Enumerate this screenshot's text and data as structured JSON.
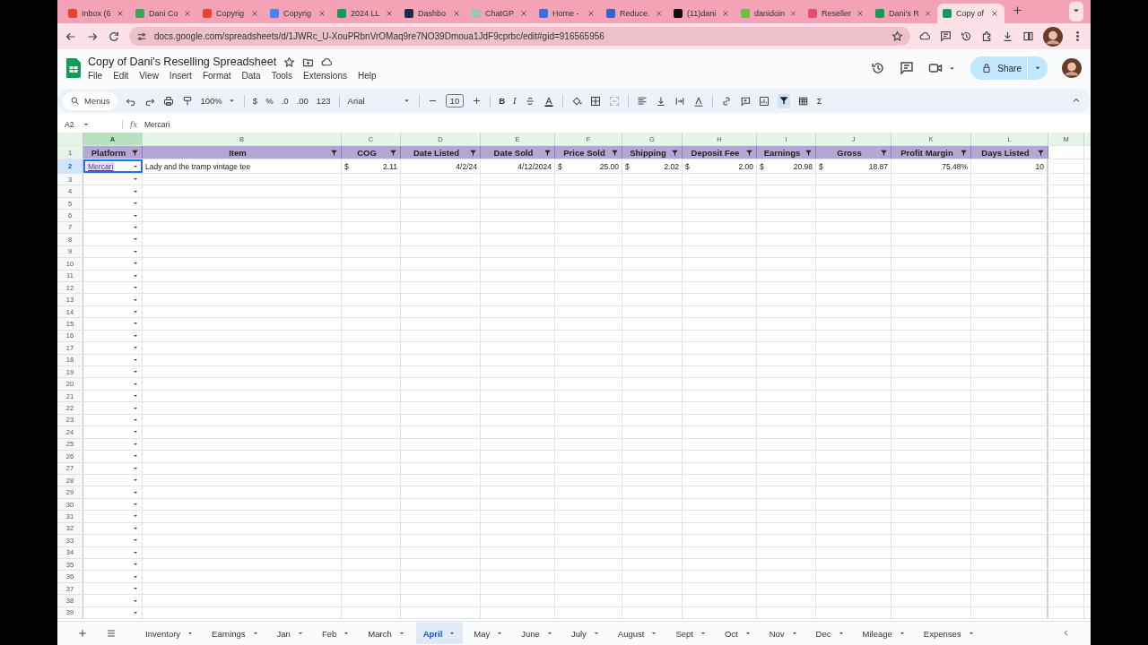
{
  "browser": {
    "tabs": [
      {
        "label": "Inbox (6",
        "color": "#ea4335",
        "selected": false
      },
      {
        "label": "Dani Co",
        "color": "#34a853",
        "selected": false
      },
      {
        "label": "Copyrig",
        "color": "#ea4335",
        "selected": false
      },
      {
        "label": "Copyrig",
        "color": "#4285f4",
        "selected": false
      },
      {
        "label": "2024 LL",
        "color": "#0f9d58",
        "selected": false
      },
      {
        "label": "Dashbo",
        "color": "#1a2a4a",
        "selected": false
      },
      {
        "label": "ChatGP",
        "color": "#9fc3b4",
        "selected": false
      },
      {
        "label": "Home - ",
        "color": "#3b6fe0",
        "selected": false
      },
      {
        "label": "Reduce.",
        "color": "#3366cc",
        "selected": false
      },
      {
        "label": "(11)dani",
        "color": "#111111",
        "selected": false
      },
      {
        "label": "danidoin",
        "color": "#6cc04a",
        "selected": false
      },
      {
        "label": "Reseller",
        "color": "#e44b6e",
        "selected": false
      },
      {
        "label": "Dani's R",
        "color": "#0f9d58",
        "selected": false
      },
      {
        "label": "Copy of",
        "color": "#0f9d58",
        "selected": true
      }
    ],
    "url": "docs.google.com/spreadsheets/d/1JWRc_U-XouPRbnVrOMaq9re7NO39Dmoua1JdF9cprbc/edit#gid=916565956"
  },
  "doc": {
    "title": "Copy of Dani's Reselling Spreadsheet",
    "menus": [
      "File",
      "Edit",
      "View",
      "Insert",
      "Format",
      "Data",
      "Tools",
      "Extensions",
      "Help"
    ],
    "share": "Share"
  },
  "toolbar": {
    "search": "Menus",
    "zoom": "100%",
    "number_formats": [
      "$",
      "%",
      ".0",
      ".00",
      "123"
    ],
    "font": "Arial",
    "font_size": "10",
    "styles": [
      "B",
      "I"
    ],
    "sum": "Σ"
  },
  "formula_bar": {
    "cell": "A2",
    "fx": "fx",
    "value": "Mercari"
  },
  "grid": {
    "columns": [
      {
        "letter": "A",
        "selected": true
      },
      {
        "letter": "B",
        "selected": false
      },
      {
        "letter": "C",
        "selected": false
      },
      {
        "letter": "D",
        "selected": false
      },
      {
        "letter": "E",
        "selected": false
      },
      {
        "letter": "F",
        "selected": false
      },
      {
        "letter": "G",
        "selected": false
      },
      {
        "letter": "H",
        "selected": false
      },
      {
        "letter": "I",
        "selected": false
      },
      {
        "letter": "J",
        "selected": false
      },
      {
        "letter": "K",
        "selected": false
      },
      {
        "letter": "L",
        "selected": false
      },
      {
        "letter": "M",
        "selected": false
      }
    ],
    "rows": [
      {
        "number": "1",
        "selected": false,
        "kind": "header",
        "cells": [
          {
            "text": "Platform"
          },
          {
            "text": "Item"
          },
          {
            "text": "COG"
          },
          {
            "text": "Date Listed"
          },
          {
            "text": "Date Sold"
          },
          {
            "text": "Price Sold"
          },
          {
            "text": "Shipping"
          },
          {
            "text": "Deposit Fee"
          },
          {
            "text": "Earnings"
          },
          {
            "text": "Gross"
          },
          {
            "text": "Profit Margin"
          },
          {
            "text": "Days Listed"
          }
        ]
      },
      {
        "number": "2",
        "selected": true,
        "kind": "data",
        "cells": [
          {
            "text": "Mercari",
            "kind": "chip"
          },
          {
            "text": "Lady and the tramp vintage tee"
          },
          {
            "currency": "$",
            "text": "2.11"
          },
          {
            "text": "4/2/24"
          },
          {
            "text": "4/12/2024"
          },
          {
            "currency": "$",
            "text": "25.00"
          },
          {
            "currency": "$",
            "text": "2.02"
          },
          {
            "currency": "$",
            "text": "2.00"
          },
          {
            "currency": "$",
            "text": "20.98"
          },
          {
            "currency": "$",
            "text": "18.87"
          },
          {
            "text": "75.48%"
          },
          {
            "text": "10"
          }
        ]
      },
      {
        "number": "3",
        "selected": false,
        "kind": "data"
      },
      {
        "number": "4",
        "selected": false,
        "kind": "data"
      },
      {
        "number": "5",
        "selected": false,
        "kind": "data"
      },
      {
        "number": "6",
        "selected": false,
        "kind": "data"
      },
      {
        "number": "7",
        "selected": false,
        "kind": "data"
      },
      {
        "number": "8",
        "selected": false,
        "kind": "data"
      },
      {
        "number": "9",
        "selected": false,
        "kind": "data"
      },
      {
        "number": "10",
        "selected": false,
        "kind": "data"
      },
      {
        "number": "11",
        "selected": false,
        "kind": "data"
      },
      {
        "number": "12",
        "selected": false,
        "kind": "data"
      },
      {
        "number": "13",
        "selected": false,
        "kind": "data"
      },
      {
        "number": "14",
        "selected": false,
        "kind": "data"
      },
      {
        "number": "15",
        "selected": false,
        "kind": "data"
      },
      {
        "number": "16",
        "selected": false,
        "kind": "data"
      },
      {
        "number": "17",
        "selected": false,
        "kind": "data"
      },
      {
        "number": "18",
        "selected": false,
        "kind": "data"
      },
      {
        "number": "19",
        "selected": false,
        "kind": "data"
      },
      {
        "number": "20",
        "selected": false,
        "kind": "data"
      },
      {
        "number": "21",
        "selected": false,
        "kind": "data"
      },
      {
        "number": "22",
        "selected": false,
        "kind": "data"
      },
      {
        "number": "23",
        "selected": false,
        "kind": "data"
      },
      {
        "number": "24",
        "selected": false,
        "kind": "data"
      },
      {
        "number": "25",
        "selected": false,
        "kind": "data"
      },
      {
        "number": "26",
        "selected": false,
        "kind": "data"
      },
      {
        "number": "27",
        "selected": false,
        "kind": "data"
      },
      {
        "number": "28",
        "selected": false,
        "kind": "data"
      },
      {
        "number": "29",
        "selected": false,
        "kind": "data"
      },
      {
        "number": "30",
        "selected": false,
        "kind": "data"
      },
      {
        "number": "31",
        "selected": false,
        "kind": "data"
      },
      {
        "number": "32",
        "selected": false,
        "kind": "data"
      },
      {
        "number": "33",
        "selected": false,
        "kind": "data"
      },
      {
        "number": "34",
        "selected": false,
        "kind": "data"
      },
      {
        "number": "35",
        "selected": false,
        "kind": "data"
      },
      {
        "number": "36",
        "selected": false,
        "kind": "data"
      },
      {
        "number": "37",
        "selected": false,
        "kind": "data"
      },
      {
        "number": "38",
        "selected": false,
        "kind": "data"
      },
      {
        "number": "39",
        "selected": false,
        "kind": "data"
      }
    ]
  },
  "sheet_tabs": [
    {
      "label": "Inventory",
      "selected": false
    },
    {
      "label": "Earnings",
      "selected": false
    },
    {
      "label": "Jan",
      "selected": false
    },
    {
      "label": "Feb",
      "selected": false
    },
    {
      "label": "March",
      "selected": false
    },
    {
      "label": "April",
      "selected": true
    },
    {
      "label": "May",
      "selected": false
    },
    {
      "label": "June",
      "selected": false
    },
    {
      "label": "July",
      "selected": false
    },
    {
      "label": "August",
      "selected": false
    },
    {
      "label": "Sept",
      "selected": false
    },
    {
      "label": "Oct",
      "selected": false
    },
    {
      "label": "Nov",
      "selected": false
    },
    {
      "label": "Dec",
      "selected": false
    },
    {
      "label": "Mileage",
      "selected": false
    },
    {
      "label": "Expenses",
      "selected": false
    }
  ]
}
